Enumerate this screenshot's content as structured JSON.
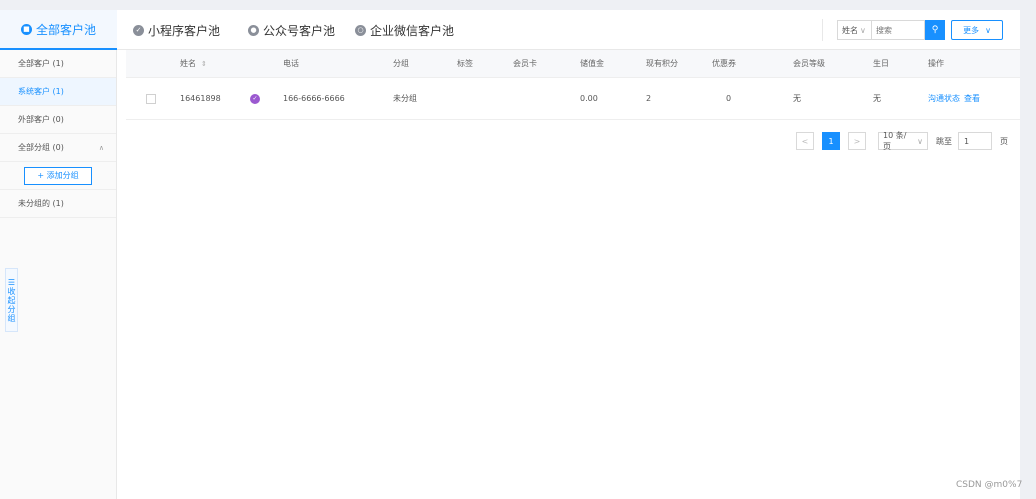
{
  "tabs": [
    {
      "label": "全部客户池",
      "icon": "pool-icon"
    },
    {
      "label": "小程序客户池",
      "icon": "miniapp-icon"
    },
    {
      "label": "公众号客户池",
      "icon": "official-account-icon"
    },
    {
      "label": "企业微信客户池",
      "icon": "wecom-icon"
    }
  ],
  "search": {
    "field": "姓名",
    "placeholder": "搜索",
    "more_label": "更多"
  },
  "sidebar": {
    "items": [
      {
        "label": "全部客户 (1)"
      },
      {
        "label": "系统客户 (1)"
      },
      {
        "label": "外部客户 (0)"
      },
      {
        "label": "全部分组 (0)"
      },
      {
        "label": "未分组的 (1)"
      }
    ],
    "add_group_label": "+ 添加分组",
    "collapse_label": [
      "收",
      "起",
      "分",
      "组"
    ]
  },
  "table": {
    "columns": [
      "姓名",
      "电话",
      "分组",
      "标签",
      "会员卡",
      "储值金",
      "现有积分",
      "优惠券",
      "会员等级",
      "生日",
      "操作"
    ],
    "rows": [
      {
        "name": "16461898",
        "phone": "166-6666-6666",
        "group": "未分组",
        "tags": "",
        "card": "",
        "balance": "0.00",
        "points": "2",
        "coupons": "0",
        "level": "无",
        "birthday": "无",
        "action_1": "沟通状态",
        "action_2": "查看"
      }
    ]
  },
  "pagination": {
    "prev": "<",
    "current": "1",
    "next": ">",
    "page_size": "10 条/页",
    "goto_label": "跳至",
    "goto_value": "1",
    "unit": "页"
  },
  "watermark": "CSDN @m0%7",
  "colors": {
    "accent": "#1890ff",
    "badge": "#9b59d0"
  }
}
